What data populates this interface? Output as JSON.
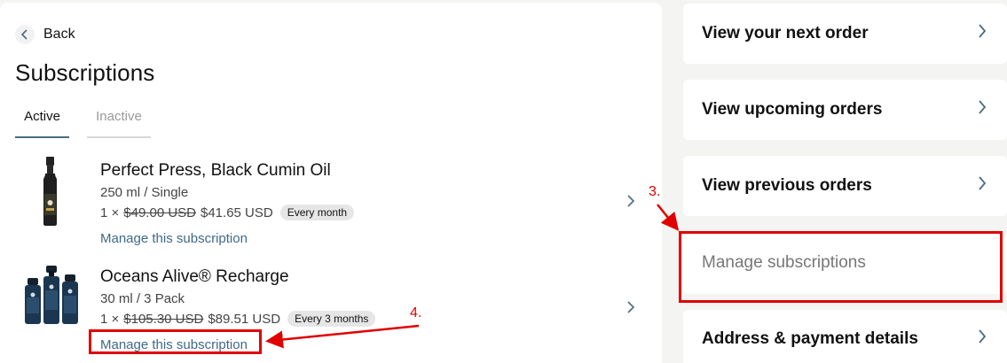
{
  "left": {
    "back_label": "Back",
    "page_title": "Subscriptions",
    "tabs": [
      {
        "label": "Active",
        "active": true
      },
      {
        "label": "Inactive",
        "active": false
      }
    ],
    "subscriptions": [
      {
        "name": "Perfect Press, Black Cumin Oil",
        "variant": "250 ml / Single",
        "quantity": "1 ×",
        "original_price": "$49.00 USD",
        "price": "$41.65 USD",
        "frequency": "Every month",
        "manage_label": "Manage this subscription",
        "image_icon": "oil-bottle-icon"
      },
      {
        "name": "Oceans Alive® Recharge",
        "variant": "30 ml / 3 Pack",
        "quantity": "1 ×",
        "original_price": "$105.30 USD",
        "price": "$89.51 USD",
        "frequency": "Every 3 months",
        "manage_label": "Manage this subscription",
        "image_icon": "dropper-bottles-icon"
      }
    ]
  },
  "right": {
    "cards": [
      {
        "label": "View your next order"
      },
      {
        "label": "View upcoming orders"
      },
      {
        "label": "View previous orders"
      },
      {
        "label": "Manage subscriptions"
      },
      {
        "label": "Address & payment details"
      }
    ]
  },
  "annotations": {
    "step3": "3.",
    "step4": "4.",
    "color": "#e00000"
  },
  "colors": {
    "link": "#3e6a87",
    "tab_underline": "#4a6b80",
    "background": "#f4f4f2"
  }
}
